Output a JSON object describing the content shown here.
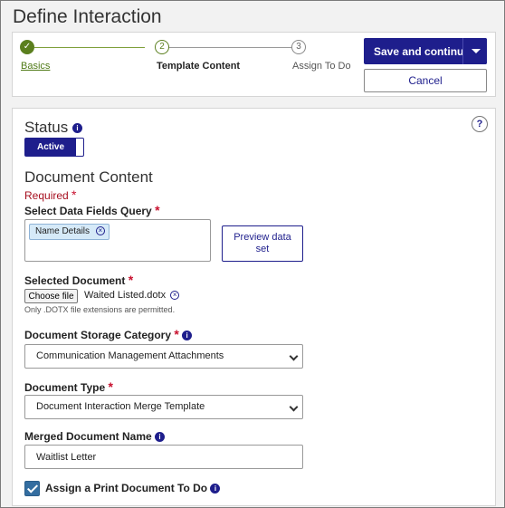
{
  "page": {
    "title": "Define Interaction"
  },
  "wizard": {
    "steps": [
      {
        "number": "",
        "label": "Basics",
        "state": "done"
      },
      {
        "number": "2",
        "label": "Template Content",
        "state": "current"
      },
      {
        "number": "3",
        "label": "Assign To Do",
        "state": "todo"
      }
    ],
    "save_label": "Save and continue",
    "cancel_label": "Cancel"
  },
  "status": {
    "title": "Status",
    "toggle_label": "Active",
    "help_label": "?"
  },
  "document": {
    "title": "Document Content",
    "required_text": "Required",
    "query_label": "Select Data Fields Query",
    "query_chips": [
      "Name Details"
    ],
    "preview_label": "Preview data set",
    "selected_label": "Selected Document",
    "choose_file_label": "Choose file",
    "file_name": "Waited Listed.dotx",
    "file_hint": "Only .DOTX file extensions are permitted.",
    "storage_label": "Document Storage Category",
    "storage_value": "Communication Management Attachments",
    "type_label": "Document Type",
    "type_value": "Document Interaction Merge Template",
    "merged_label": "Merged Document Name",
    "merged_value": "Waitlist Letter",
    "print_label": "Assign a Print Document To Do",
    "print_checked": true
  },
  "colors": {
    "primary": "#1e1e8c",
    "success": "#5b7f1e",
    "required": "#c8102e",
    "checkbox": "#336da0"
  },
  "icons": [
    "check-icon",
    "info-icon",
    "help-icon",
    "remove-chip-icon",
    "chevron-down-icon",
    "caret-down-icon"
  ]
}
